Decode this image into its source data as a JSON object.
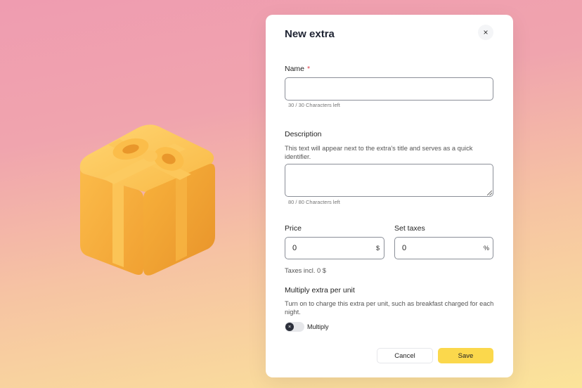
{
  "modal": {
    "title": "New extra",
    "close_glyph": "×"
  },
  "name": {
    "label": "Name",
    "required_mark": "*",
    "value": "",
    "counter": "30 / 30 Characters left"
  },
  "description": {
    "label": "Description",
    "helper": "This text will appear next to the extra's title and serves as a quick identifier.",
    "value": "",
    "counter": "80 / 80 Characters left"
  },
  "price": {
    "label": "Price",
    "value": "0",
    "suffix": "$"
  },
  "taxes": {
    "label": "Set taxes",
    "value": "0",
    "suffix": "%",
    "summary": "Taxes incl. 0 $"
  },
  "multiply": {
    "title": "Multiply extra per unit",
    "helper": "Turn on to charge this extra per unit, such as breakfast charged for each night.",
    "toggle_label": "Multiply",
    "toggle_glyph": "×",
    "enabled": false
  },
  "actions": {
    "cancel_label": "Cancel",
    "save_label": "Save"
  },
  "colors": {
    "accent": "#fbd84c",
    "required": "#e0434e",
    "gift": "#f7b43e"
  },
  "icons": {
    "hero": "gift-box-icon",
    "close": "close-icon"
  }
}
